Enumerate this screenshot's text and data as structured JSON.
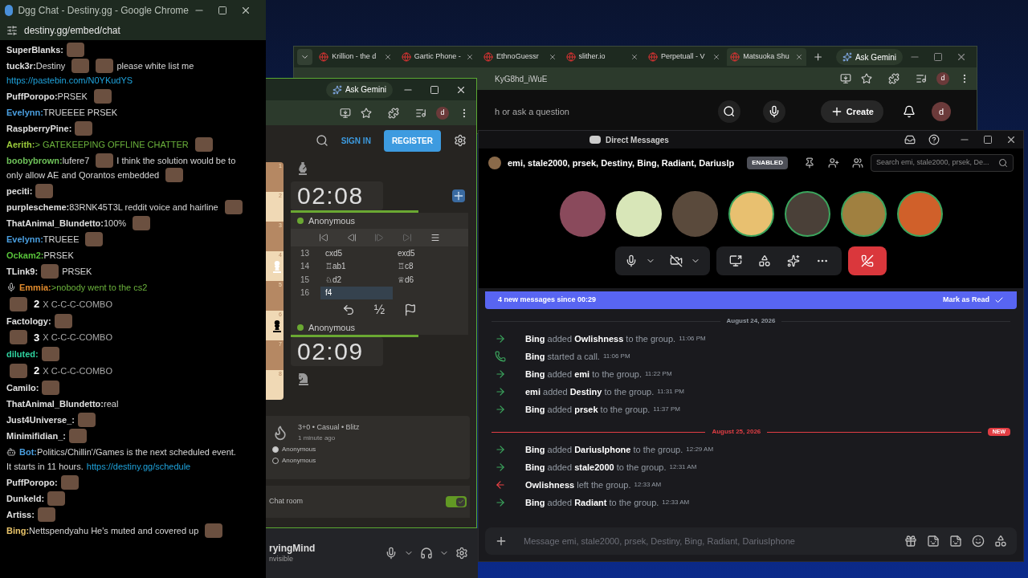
{
  "chat_window": {
    "title": "Dgg Chat - Destiny.gg - Google Chrome",
    "address": "destiny.gg/embed/chat",
    "messages": [
      {
        "kind": "message",
        "user": "SuperBlanks:",
        "color": "#e0e0e0",
        "segments": [
          {
            "kind": "emote"
          }
        ]
      },
      {
        "kind": "message",
        "user": "tuck3r:",
        "color": "#e0e0e0",
        "segments": [
          {
            "kind": "text",
            "text": "Destiny"
          },
          {
            "kind": "emote"
          },
          {
            "kind": "emote"
          },
          {
            "kind": "text",
            "text": "please white list me"
          },
          {
            "kind": "link",
            "text": "https://pastebin.com/N0YKudYS"
          }
        ]
      },
      {
        "kind": "message",
        "user": "PuffPoropo:",
        "color": "#e0e0e0",
        "segments": [
          {
            "kind": "text",
            "text": "PRSEK"
          },
          {
            "kind": "emote"
          }
        ]
      },
      {
        "kind": "message",
        "user": "Evelynn:",
        "color": "#4a9fe0",
        "segments": [
          {
            "kind": "text",
            "text": "TRUEEEE PRSEK"
          }
        ]
      },
      {
        "kind": "message",
        "user": "RaspberryPine:",
        "color": "#e0e0e0",
        "segments": [
          {
            "kind": "emote"
          }
        ]
      },
      {
        "kind": "message",
        "user": "Aerith:",
        "color": "#9ccc3c",
        "segments": [
          {
            "kind": "green",
            "text": "> GATEKEEPING OFFLINE CHATTER"
          },
          {
            "kind": "emote"
          }
        ]
      },
      {
        "kind": "message",
        "user": "boobybrown:",
        "color": "#6fc35a",
        "segments": [
          {
            "kind": "text",
            "text": "lufere7"
          },
          {
            "kind": "emote"
          },
          {
            "kind": "text",
            "text": "I think the solution would be to"
          },
          {
            "kind": "text",
            "text": "only allow AE and Qorantos embedded"
          },
          {
            "kind": "emote"
          }
        ]
      },
      {
        "kind": "message",
        "user": "peciti:",
        "color": "#e0e0e0",
        "segments": [
          {
            "kind": "emote"
          }
        ]
      },
      {
        "kind": "message",
        "user": "purplescheme:",
        "color": "#e0e0e0",
        "segments": [
          {
            "kind": "text",
            "text": "83RNK45T3L reddit voice and hairline"
          },
          {
            "kind": "emote"
          }
        ]
      },
      {
        "kind": "message",
        "user": "ThatAnimal_Blundetto:",
        "color": "#e0e0e0",
        "segments": [
          {
            "kind": "text",
            "text": "100%"
          },
          {
            "kind": "emote"
          }
        ]
      },
      {
        "kind": "message",
        "user": "Evelynn:",
        "color": "#4a9fe0",
        "segments": [
          {
            "kind": "text",
            "text": "TRUEEE"
          },
          {
            "kind": "emote"
          }
        ]
      },
      {
        "kind": "message",
        "user": "Ockam2:",
        "color": "#58c33a",
        "segments": [
          {
            "kind": "text",
            "text": "PRSEK"
          }
        ]
      },
      {
        "kind": "message",
        "user": "TLink9:",
        "color": "#e0e0e0",
        "segments": [
          {
            "kind": "emote"
          },
          {
            "kind": "text",
            "text": "PRSEK"
          }
        ]
      },
      {
        "kind": "voice_message",
        "user": "Emmia:",
        "color": "#e08a2c",
        "segments": [
          {
            "kind": "green",
            "text": ">nobody went to the cs2"
          }
        ]
      },
      {
        "kind": "combo",
        "count": "2",
        "label": "X C-C-C-COMBO"
      },
      {
        "kind": "message",
        "user": "Factology:",
        "color": "#e0e0e0",
        "segments": [
          {
            "kind": "emote"
          }
        ]
      },
      {
        "kind": "combo",
        "count": "3",
        "label": "X C-C-C-COMBO"
      },
      {
        "kind": "message",
        "user": "diluted:",
        "color": "#2fd3a0",
        "segments": [
          {
            "kind": "emote"
          }
        ]
      },
      {
        "kind": "combo",
        "count": "2",
        "label": "X C-C-C-COMBO"
      },
      {
        "kind": "message",
        "user": "Camilo:",
        "color": "#e0e0e0",
        "segments": [
          {
            "kind": "emote"
          }
        ]
      },
      {
        "kind": "message",
        "user": "ThatAnimal_Blundetto:",
        "color": "#e0e0e0",
        "segments": [
          {
            "kind": "text",
            "text": "real"
          }
        ]
      },
      {
        "kind": "message",
        "user": "Just4Universe_:",
        "color": "#e0e0e0",
        "segments": [
          {
            "kind": "emote"
          }
        ]
      },
      {
        "kind": "message",
        "user": "Minimifidian_:",
        "color": "#e0e0e0",
        "segments": [
          {
            "kind": "emote"
          }
        ]
      },
      {
        "kind": "bot_message",
        "user": "Bot:",
        "color": "#4a9fe0",
        "segments": [
          {
            "kind": "text",
            "text": "Politics/Chillin'/Games is the next scheduled event."
          },
          {
            "kind": "text",
            "text": "It starts in 11 hours."
          },
          {
            "kind": "link",
            "text": "https://destiny.gg/schedule"
          }
        ]
      },
      {
        "kind": "message",
        "user": "PuffPoropo:",
        "color": "#e0e0e0",
        "segments": [
          {
            "kind": "emote"
          }
        ]
      },
      {
        "kind": "message",
        "user": "Dunkeld:",
        "color": "#e0e0e0",
        "segments": [
          {
            "kind": "emote"
          }
        ]
      },
      {
        "kind": "message",
        "user": "Artiss:",
        "color": "#e0e0e0",
        "segments": [
          {
            "kind": "emote"
          }
        ]
      },
      {
        "kind": "message",
        "user": "Bing:",
        "color": "#e9c46a",
        "segments": [
          {
            "kind": "text",
            "text": "Nettspendyahu He's muted and covered up"
          },
          {
            "kind": "emote"
          }
        ]
      }
    ]
  },
  "back_browser": {
    "tabs": [
      {
        "label": "Krillion - the d",
        "selected": false
      },
      {
        "label": "Gartic Phone -",
        "selected": false
      },
      {
        "label": "EthnoGuessr",
        "selected": false
      },
      {
        "label": "slither.io",
        "selected": false
      },
      {
        "label": "Perpetuall - V",
        "selected": false
      },
      {
        "label": "Matsuoka Shu",
        "selected": true
      }
    ],
    "ask_button": "Ask Gemini",
    "address": "KyG8hd_iWuE",
    "profile": "d",
    "search_placeholder": "h or ask a question",
    "create_button": "Create",
    "youtube_avatar": "d"
  },
  "chess_window": {
    "ask_button": "Ask Gemini",
    "profile": "d",
    "sign_in": "SIGN IN",
    "register": "REGISTER",
    "ranks": [
      "1",
      "2",
      "3",
      "4",
      "5",
      "6",
      "7",
      "8"
    ],
    "top_clock": "02:08",
    "top_player": "Anonymous",
    "top_timer": {
      "level": 0.72
    },
    "moves": [
      {
        "number": "13",
        "white": "cxd5",
        "black": "exd5",
        "selected": false
      },
      {
        "number": "14",
        "white": "♖ab1",
        "black": "♖c8",
        "selected": false
      },
      {
        "number": "15",
        "white": "♘d2",
        "black": "♕d6",
        "selected": false
      },
      {
        "number": "16",
        "white": "f4",
        "selected": true
      }
    ],
    "draw_offer": "½",
    "bottom_player": "Anonymous",
    "bottom_clock": "02:09",
    "bottom_timer": {
      "level": 0.72
    },
    "game_type": "3+0 • Casual • Blitz",
    "game_time": "1 minute ago",
    "players": [
      {
        "name": "Anonymous",
        "color": "#cccccc"
      },
      {
        "name": "Anonymous",
        "color": "#262421"
      }
    ],
    "chat_room": {
      "label": "Chat room",
      "on": true
    }
  },
  "under_panel": {
    "name": "ryingMind",
    "status": "nvisible"
  },
  "discord": {
    "title": "Direct Messages",
    "channel": "emi, stale2000, prsek, Destiny, Bing, Radiant, Dariuslp",
    "badge": "ENABLED",
    "search_placeholder": "Search emi, stale2000, prsek, De...",
    "participants": [
      {
        "color": "#8a4a5c",
        "speaking": false
      },
      {
        "color": "#d8e6b8",
        "speaking": false
      },
      {
        "color": "#5a4a3c",
        "speaking": false
      },
      {
        "color": "#e8c070",
        "speaking": true
      },
      {
        "color": "#4a4038",
        "speaking": true
      },
      {
        "color": "#a08040",
        "speaking": true
      },
      {
        "color": "#d0602a",
        "speaking": true
      }
    ],
    "banner": {
      "text": "4 new messages since 00:29",
      "action": "Mark as Read"
    },
    "days": [
      {
        "date": "August 24, 2026",
        "new": false,
        "messages": [
          {
            "kind": "join",
            "text": "**Bing** added **Owlishness** to the group.",
            "time": "11:06 PM"
          },
          {
            "kind": "call",
            "text": "**Bing** started a call.",
            "time": "11:06 PM"
          },
          {
            "kind": "join",
            "text": "**Bing** added **emi** to the group.",
            "time": "11:22 PM"
          },
          {
            "kind": "join",
            "text": "**emi** added **Destiny** to the group.",
            "time": "11:31 PM"
          },
          {
            "kind": "join",
            "text": "**Bing** added **prsek** to the group.",
            "time": "11:37 PM"
          }
        ]
      },
      {
        "date": "August 25, 2026",
        "new": true,
        "new_label": "NEW",
        "messages": [
          {
            "kind": "join",
            "text": "**Bing** added **DariusIphone** to the group.",
            "time": "12:29 AM"
          },
          {
            "kind": "join",
            "text": "**Bing** added **stale2000** to the group.",
            "time": "12:31 AM"
          },
          {
            "kind": "leave",
            "text": "**Owlishness** left the group.",
            "time": "12:33 AM"
          },
          {
            "kind": "join",
            "text": "**Bing** added **Radiant** to the group.",
            "time": "12:33 AM"
          }
        ]
      }
    ],
    "input_placeholder": "Message emi, stale2000, prsek, Destiny, Bing, Radiant, DariusIphone"
  }
}
